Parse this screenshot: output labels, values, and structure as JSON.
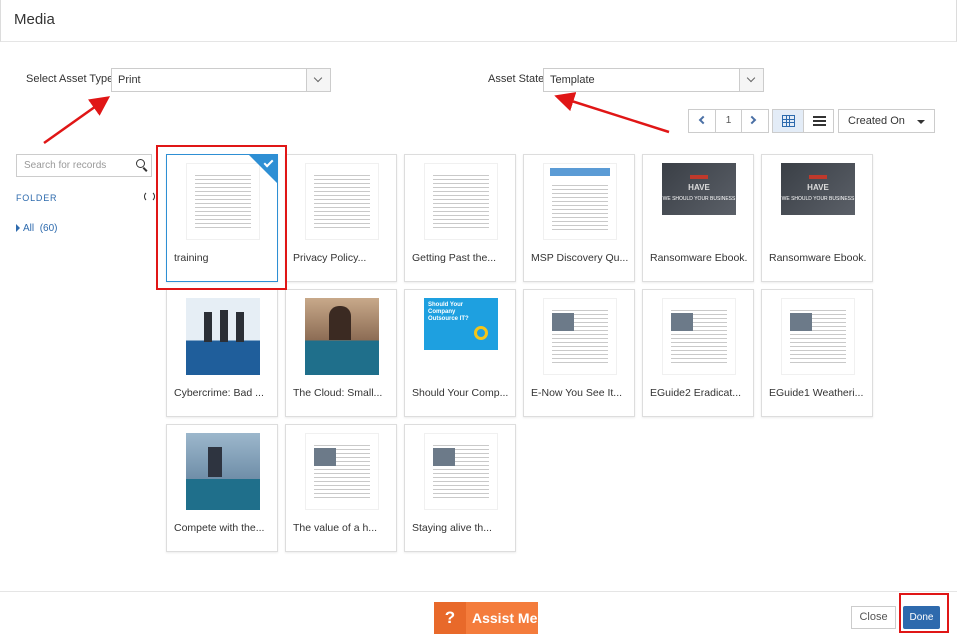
{
  "header": {
    "title": "Media"
  },
  "filters": {
    "asset_type_label": "Select Asset Type:",
    "asset_type_value": "Print",
    "asset_state_label": "Asset State:",
    "asset_state_value": "Template"
  },
  "pager": {
    "page": "1"
  },
  "sort": {
    "value": "Created On"
  },
  "sidebar": {
    "search_placeholder": "Search for records",
    "folder_label": "FOLDER",
    "all_label": "All",
    "all_count": "(60)"
  },
  "assets": [
    {
      "title": "training",
      "thumb": "doc",
      "selected": true
    },
    {
      "title": "Privacy Policy...",
      "thumb": "doc"
    },
    {
      "title": "Getting Past the...",
      "thumb": "doc"
    },
    {
      "title": "MSP Discovery Qu...",
      "thumb": "doc-blue"
    },
    {
      "title": "Ransomware Ebook...",
      "thumb": "dark"
    },
    {
      "title": "Ransomware Ebook...",
      "thumb": "dark"
    },
    {
      "title": "Cybercrime: Bad ...",
      "thumb": "people"
    },
    {
      "title": "The Cloud: Small...",
      "thumb": "woman"
    },
    {
      "title": "Should Your Comp...",
      "thumb": "outsource"
    },
    {
      "title": "E-Now You See It...",
      "thumb": "article"
    },
    {
      "title": "EGuide2 Eradicat...",
      "thumb": "article"
    },
    {
      "title": "EGuide1 Weatheri...",
      "thumb": "article"
    },
    {
      "title": "Compete with the...",
      "thumb": "man"
    },
    {
      "title": "The value of a h...",
      "thumb": "article"
    },
    {
      "title": "Staying alive th...",
      "thumb": "article"
    }
  ],
  "thumb_text": {
    "outsource_title": "Should Your Company Outsource IT?",
    "dark_line1": "HAVE",
    "dark_line2": "WE SHOULD YOUR BUSINESS"
  },
  "footer": {
    "assist_q": "?",
    "assist_label": "Assist Me",
    "close_label": "Close",
    "done_label": "Done"
  },
  "colors": {
    "accent": "#2e6aad",
    "selected_border": "#2e8fd4",
    "annotation_red": "#e01616",
    "assist_orange": "#f47c3c"
  }
}
